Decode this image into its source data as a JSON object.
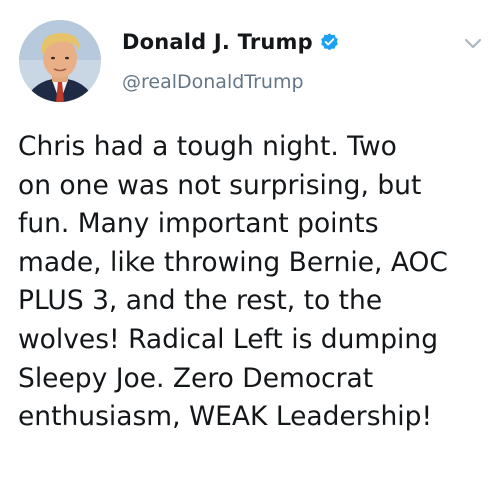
{
  "author": {
    "display_name": "Donald J. Trump",
    "handle": "@realDonaldTrump",
    "verified": true,
    "avatar_icon": "profile-photo"
  },
  "tweet": {
    "lines": [
      "Chris had a tough night. Two",
      "on one was not surprising, but",
      "fun. Many important points",
      "made, like throwing Bernie, AOC",
      "PLUS 3, and the rest, to the",
      "wolves! Radical Left is dumping",
      "Sleepy Joe. Zero Democrat",
      "enthusiasm, WEAK Leadership!"
    ]
  },
  "icons": {
    "verified": "verified-badge-icon",
    "menu": "chevron-down-icon"
  },
  "colors": {
    "verified_blue": "#1da1f2",
    "text_primary": "#14171a",
    "text_secondary": "#657786",
    "caret_gray": "#aab8c2"
  }
}
